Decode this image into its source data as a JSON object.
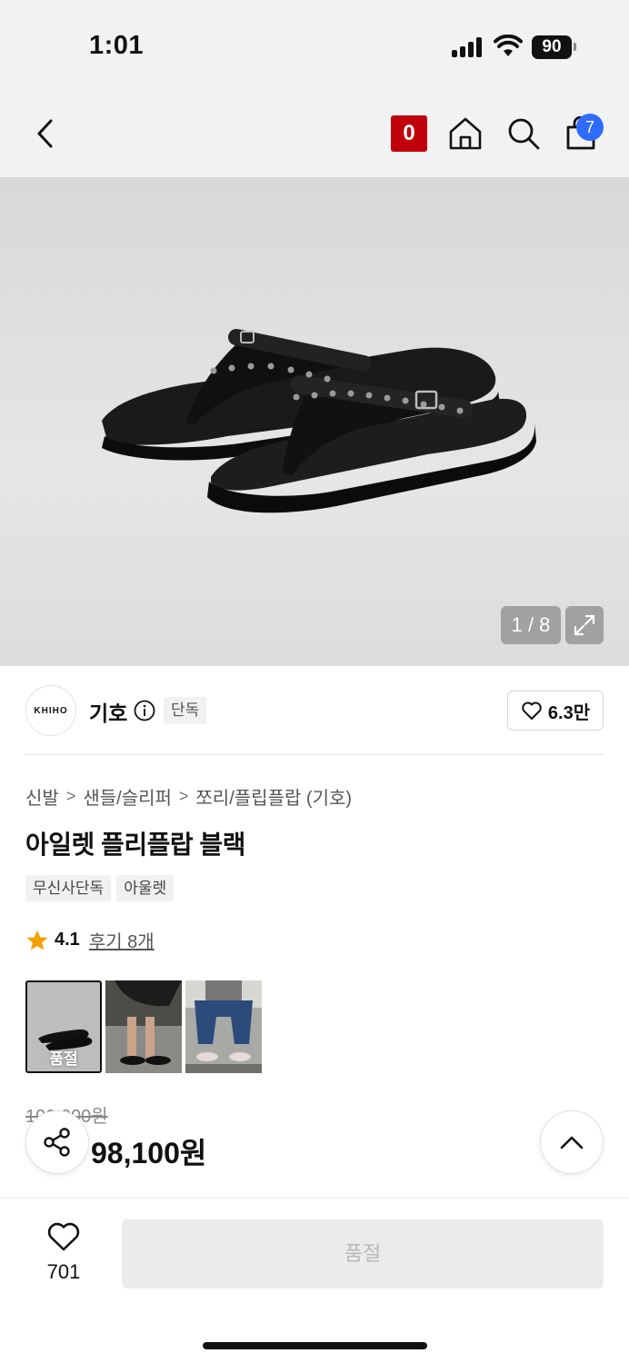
{
  "status_bar": {
    "time": "1:01",
    "battery": "90"
  },
  "nav": {
    "mark_label": "0",
    "cart_count": "7"
  },
  "gallery": {
    "counter": "1 / 8"
  },
  "brand": {
    "logo_text": "KHIHO",
    "name": "기호",
    "exclusive_tag": "단독",
    "likes": "6.3만"
  },
  "breadcrumb": [
    "신발",
    "샌들/슬리퍼",
    "쪼리/플립플랍 (기호)"
  ],
  "product": {
    "title": "아일렛 플리플랍 블랙",
    "tags": [
      "무신사단독",
      "아울렛"
    ],
    "rating": "4.1",
    "review_link": "후기 8개",
    "thumb_soldout_label": "품절",
    "original_price": "100,000원",
    "sale_price": "98,100원"
  },
  "bottom_bar": {
    "wish_count": "701",
    "soldout_button": "품절"
  },
  "colors": {
    "mark_red": "#c0000b",
    "badge_blue": "#2f6bff",
    "star": "#f5a100"
  },
  "icons": [
    "back-icon",
    "home-icon",
    "search-icon",
    "shopping-bag-icon",
    "expand-icon",
    "info-icon",
    "heart-icon",
    "star-icon",
    "share-icon",
    "chevron-up-icon"
  ]
}
